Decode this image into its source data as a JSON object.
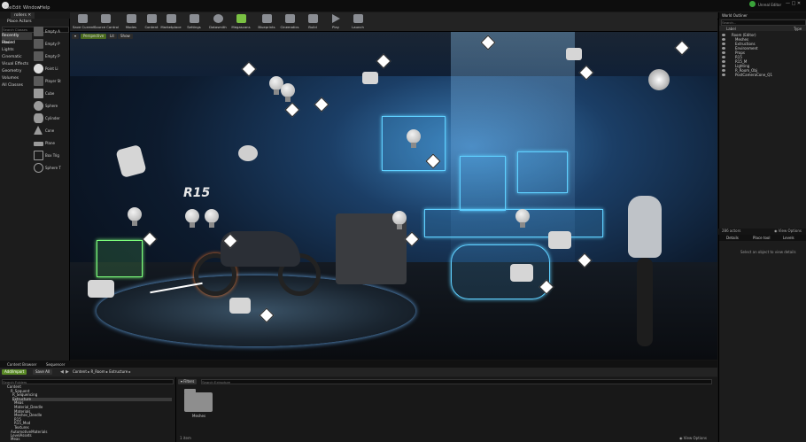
{
  "menubar": {
    "items": [
      "File",
      "Edit",
      "Window",
      "Help"
    ]
  },
  "tabs": {
    "level": "rollers",
    "right_tab": "Unreal Editor"
  },
  "place_actors": {
    "title": "Place Actors",
    "search_placeholder": "Search Classes",
    "categories": [
      "Recently Placed",
      "Basic",
      "Lights",
      "Cinematic",
      "Visual Effects",
      "Geometry",
      "Volumes",
      "All Classes"
    ],
    "actors": [
      "Empty A",
      "Empty P",
      "Empty P",
      "Point Li",
      "Player St",
      "Cube",
      "Sphere",
      "Cylinder",
      "Cone",
      "Plane",
      "Box Trig",
      "Sphere T"
    ]
  },
  "toolbar": {
    "buttons": [
      "Save Current",
      "Source Control",
      "Modes",
      "Content",
      "Marketplace",
      "Settings",
      "Datasmith",
      "Megascans",
      "Blueprints",
      "Cinematics",
      "Build",
      "Play",
      "Launch"
    ]
  },
  "viewport": {
    "tabs": [
      "Perspective",
      "Lit",
      "Show"
    ],
    "scene_text": "R15"
  },
  "world_outliner": {
    "title": "World Outliner",
    "search_placeholder": "Search...",
    "col_label": "Label",
    "col_type": "Type",
    "rows": [
      "Room (Editor)",
      "Meshes",
      "Extructions",
      "Environment",
      "Props",
      "R15",
      "R15_M",
      "Lighting",
      "R_Room_Obj",
      "PostCameraCone_Q1"
    ],
    "actor_count": "286 actors",
    "view_options": "View Options"
  },
  "details": {
    "tabs": [
      "Details",
      "Place tool",
      "Levels"
    ],
    "empty_text": "Select an object to view details"
  },
  "content_browser": {
    "tabs": [
      "Content Browser",
      "Sequencer"
    ],
    "add_import": "Add/Import",
    "save_all": "Save All",
    "breadcrumb": [
      "Content",
      "R_Room",
      "Extructure"
    ],
    "search_folders_placeholder": "Search Folders",
    "filters": "Filters",
    "search_placeholder": "Search Extructure",
    "tree": [
      "Content",
      "R_Sequent",
      "R_Sequencing",
      "Extructure",
      "Meas",
      "Material_Deedle",
      "Materials",
      "Meshes_Deedle",
      "R15",
      "R15_Mod",
      "Textures",
      "AutomotiveMaterials",
      "LevelAssets",
      "Meas"
    ],
    "asset_name": "Meshes",
    "item_count": "1 item",
    "view_options": "View Options"
  }
}
